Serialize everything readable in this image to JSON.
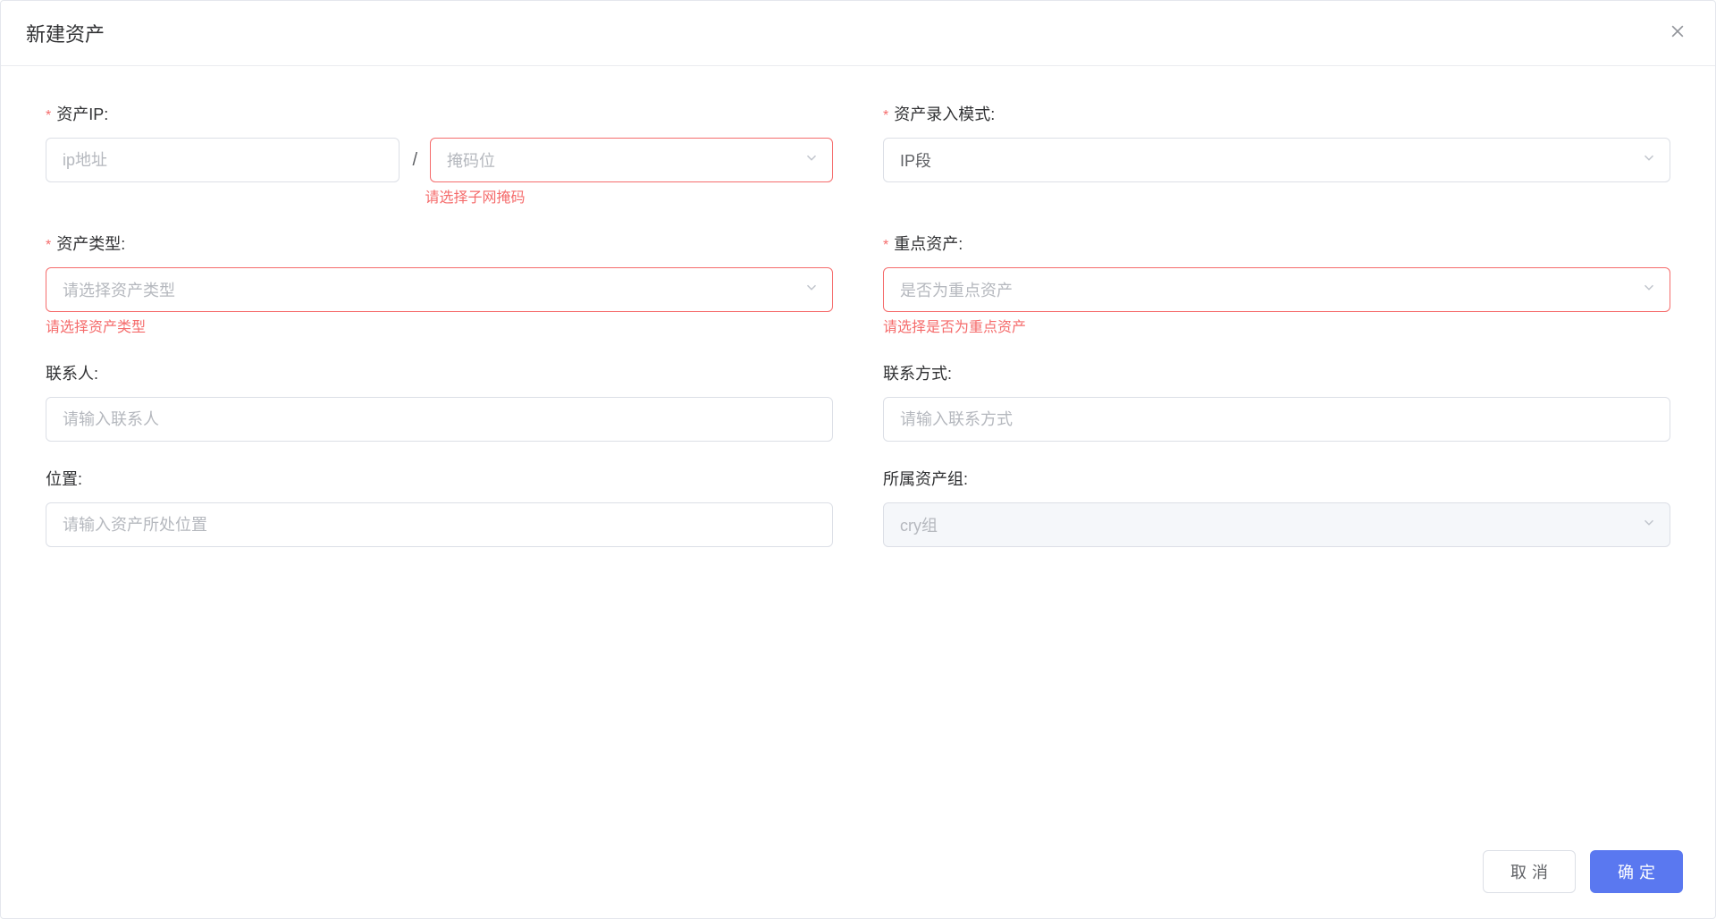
{
  "dialog": {
    "title": "新建资产",
    "cancel_label": "取消",
    "confirm_label": "确定"
  },
  "form": {
    "asset_ip": {
      "label": "资产IP:",
      "ip_placeholder": "ip地址",
      "mask_placeholder": "掩码位",
      "mask_error": "请选择子网掩码"
    },
    "entry_mode": {
      "label": "资产录入模式:",
      "value": "IP段"
    },
    "asset_type": {
      "label": "资产类型:",
      "placeholder": "请选择资产类型",
      "error": "请选择资产类型"
    },
    "key_asset": {
      "label": "重点资产:",
      "placeholder": "是否为重点资产",
      "error": "请选择是否为重点资产"
    },
    "contact_person": {
      "label": "联系人:",
      "placeholder": "请输入联系人"
    },
    "contact_method": {
      "label": "联系方式:",
      "placeholder": "请输入联系方式"
    },
    "location": {
      "label": "位置:",
      "placeholder": "请输入资产所处位置"
    },
    "asset_group": {
      "label": "所属资产组:",
      "value": "cry组"
    }
  }
}
